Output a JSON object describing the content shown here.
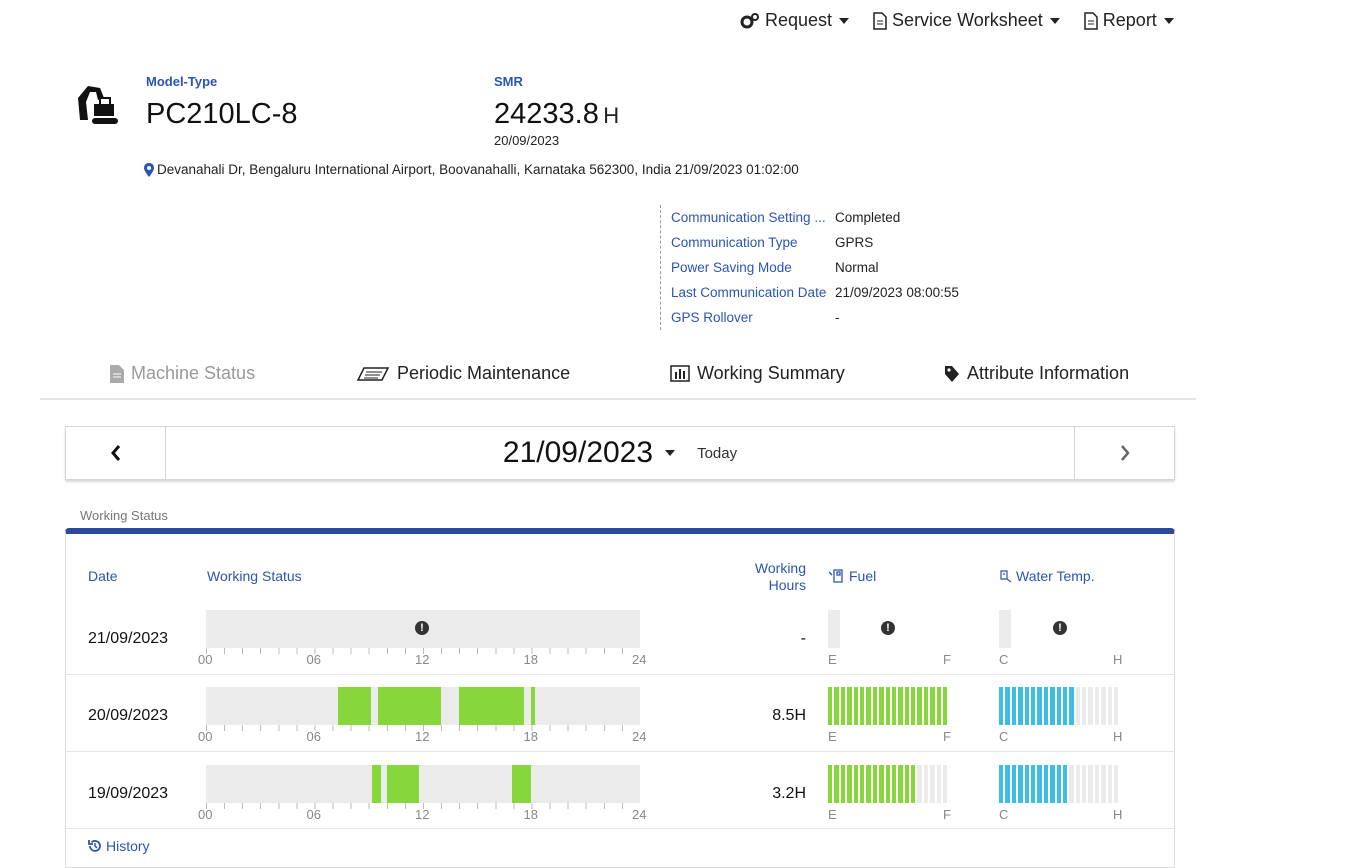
{
  "menu": {
    "request": "Request",
    "service_worksheet": "Service Worksheet",
    "report": "Report"
  },
  "machine": {
    "model_label": "Model-Type",
    "model": "PC210LC-8",
    "smr_label": "SMR",
    "smr_value": "24233.8",
    "smr_unit": "H",
    "smr_date": "20/09/2023",
    "location": "Devanahali Dr, Bengaluru International Airport, Boovanahalli, Karnataka 562300, India 21/09/2023 01:02:00"
  },
  "info": [
    {
      "key": "Communication Setting ...",
      "value": "Completed"
    },
    {
      "key": "Communication Type",
      "value": "GPRS"
    },
    {
      "key": "Power Saving Mode",
      "value": "Normal"
    },
    {
      "key": "Last Communication Date",
      "value": "21/09/2023 08:00:55"
    },
    {
      "key": "GPS Rollover",
      "value": "-"
    }
  ],
  "tabs": [
    {
      "label": "Machine Status",
      "icon": "document-icon"
    },
    {
      "label": "Periodic Maintenance",
      "icon": "book-icon"
    },
    {
      "label": "Working Summary",
      "icon": "bar-chart-icon"
    },
    {
      "label": "Attribute Information",
      "icon": "tag-icon"
    }
  ],
  "datenav": {
    "date": "21/09/2023",
    "today": "Today"
  },
  "panel": {
    "tab": "Working Status",
    "headers": {
      "date": "Date",
      "working_status": "Working Status",
      "working_hours": "Working Hours",
      "fuel": "Fuel",
      "water_temp": "Water Temp."
    },
    "axis_labels": [
      "00",
      "06",
      "12",
      "18",
      "24"
    ],
    "fuel_labels": {
      "low": "E",
      "high": "F"
    },
    "temp_labels": {
      "low": "C",
      "high": "H"
    },
    "rows": [
      {
        "date": "21/09/2023",
        "hours": "-",
        "warning": true,
        "segments": [],
        "fuel_level": 0,
        "temp_level": 0
      },
      {
        "date": "20/09/2023",
        "hours": "8.5H",
        "warning": false,
        "segments": [
          [
            7.3,
            9.1
          ],
          [
            9.5,
            13.0
          ],
          [
            14.0,
            17.6
          ],
          [
            17.95,
            18.2
          ]
        ],
        "fuel_level": 1.0,
        "temp_level": 0.65
      },
      {
        "date": "19/09/2023",
        "hours": "3.2H",
        "warning": false,
        "segments": [
          [
            9.2,
            9.7
          ],
          [
            10.0,
            11.8
          ],
          [
            16.9,
            17.95
          ]
        ],
        "fuel_level": 0.72,
        "temp_level": 0.6
      }
    ],
    "history": "History"
  },
  "colors": {
    "accent": "#2a55b5",
    "working": "#87d63b",
    "temp": "#3bbde6",
    "panel_border": "#2a4a9f"
  }
}
